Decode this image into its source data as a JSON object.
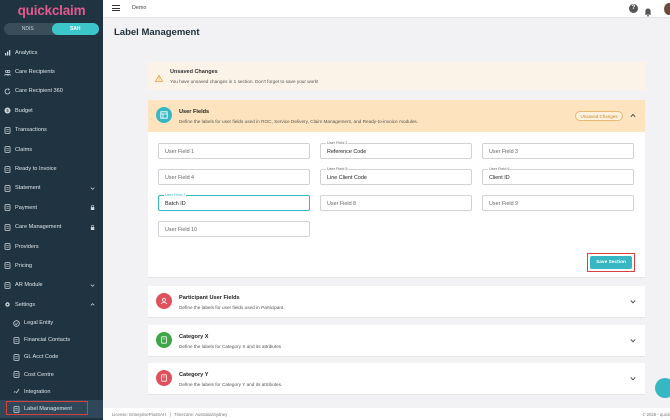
{
  "app": {
    "logo": "quickclaim"
  },
  "segment": {
    "options": [
      "NDIS",
      "SAH"
    ],
    "active": "SAH"
  },
  "sidebar": {
    "items": [
      {
        "label": "Analytics",
        "icon": "analytics-icon"
      },
      {
        "label": "Care Recipients",
        "icon": "users-icon"
      },
      {
        "label": "Care Recipient 360",
        "icon": "refresh-icon"
      },
      {
        "label": "Budget",
        "icon": "dollar-icon"
      },
      {
        "label": "Transactions",
        "icon": "document-icon"
      },
      {
        "label": "Claims",
        "icon": "receipt-icon"
      },
      {
        "label": "Ready to Invoice",
        "icon": "invoice-icon"
      },
      {
        "label": "Statement",
        "icon": "statement-icon",
        "trail": "chevron-down"
      },
      {
        "label": "Payment",
        "icon": "payment-icon",
        "trail": "lock"
      },
      {
        "label": "Care Management",
        "icon": "care-icon",
        "trail": "lock"
      },
      {
        "label": "Providers",
        "icon": "provider-icon"
      },
      {
        "label": "Pricing",
        "icon": "pricing-icon"
      },
      {
        "label": "AR Module",
        "icon": "ar-icon",
        "trail": "chevron-down"
      },
      {
        "label": "Settings",
        "icon": "gear-icon",
        "trail": "chevron-up"
      }
    ],
    "sub_items": [
      {
        "label": "Legal Entity",
        "icon": "badge-icon"
      },
      {
        "label": "Financial Contacts",
        "icon": "contacts-icon"
      },
      {
        "label": "GL Acct Code",
        "icon": "file-icon"
      },
      {
        "label": "Cost Centre",
        "icon": "file-icon"
      },
      {
        "label": "Integration",
        "icon": "link-icon"
      },
      {
        "label": "Label Management",
        "icon": "label-icon",
        "selected": true
      }
    ]
  },
  "topbar": {
    "breadcrumb": "Demo"
  },
  "page": {
    "title": "Label Management"
  },
  "banner": {
    "title": "Unsaved Changes",
    "body": "You have unsaved changes in 1 section. Don't forget to save your work!"
  },
  "user_fields": {
    "title": "User Fields",
    "description": "Define the labels for user fields used in ROC, Service Delivery, Claim Management, and Ready-to-invoice modules.",
    "badge": "Unsaved Changes",
    "fields": [
      {
        "label": "",
        "value": "",
        "placeholder": "User Field 1"
      },
      {
        "label": "User Field 2",
        "value": "Reference Code",
        "placeholder": ""
      },
      {
        "label": "",
        "value": "",
        "placeholder": "User Field 3"
      },
      {
        "label": "",
        "value": "",
        "placeholder": "User Field 4"
      },
      {
        "label": "User Field 5",
        "value": "Line Client Code",
        "placeholder": ""
      },
      {
        "label": "User Field 6",
        "value": "Client ID",
        "placeholder": ""
      },
      {
        "label": "User Field 7",
        "value": "Batch ID",
        "placeholder": "",
        "focused": true
      },
      {
        "label": "",
        "value": "",
        "placeholder": "User Field 8"
      },
      {
        "label": "",
        "value": "",
        "placeholder": "User Field 9"
      },
      {
        "label": "",
        "value": "",
        "placeholder": "User Field 10"
      }
    ],
    "save_label": "Save Section"
  },
  "sections": [
    {
      "title": "Participant User Fields",
      "description": "Define the labels for user fields used in Participant.",
      "color": "#e0505d"
    },
    {
      "title": "Category X",
      "description": "Define the labels for Category X and its attributes",
      "color": "#3fa54a"
    },
    {
      "title": "Category Y",
      "description": "Define the labels for Category Y and its attributes.",
      "color": "#e0505d"
    }
  ],
  "footer": {
    "license": "License: EnterprisePlusSAH",
    "separator": "|",
    "timezone": "Timezone: Australia/Sydney",
    "copyright": "© 2026 - quick"
  },
  "colors": {
    "sidebar": "#1f3340",
    "accent": "#37b7c4",
    "brand": "#e35a8f",
    "warning_bg": "#fde4bf"
  }
}
